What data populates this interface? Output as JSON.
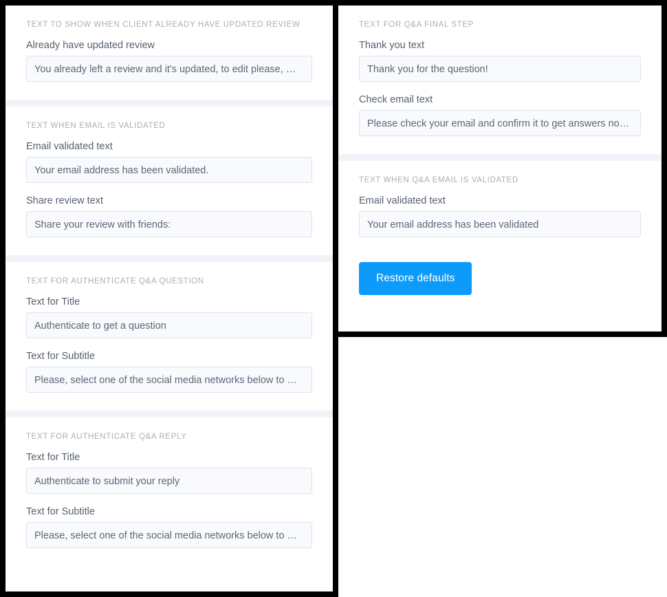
{
  "theme": {
    "accent": "#0d9bfb",
    "panel_border": "#000000",
    "divider": "#f1f3f8",
    "input_bg": "#f9fafd",
    "input_border": "#dfe3ee",
    "label_color": "#55606e",
    "section_head_color": "#a9aeb8"
  },
  "left_panel": {
    "sections": [
      {
        "heading": "TEXT TO SHOW WHEN CLIENT ALREADY HAVE UPDATED REVIEW",
        "fields": [
          {
            "label": "Already have updated review",
            "value": "You already left a review and it's updated, to edit please, …"
          }
        ]
      },
      {
        "heading": "TEXT WHEN EMAIL IS VALIDATED",
        "fields": [
          {
            "label": "Email validated text",
            "value": "Your email address has been validated."
          },
          {
            "label": "Share review text",
            "value": "Share your review with friends:"
          }
        ]
      },
      {
        "heading": "TEXT FOR AUTHENTICATE Q&A QUESTION",
        "fields": [
          {
            "label": "Text for Title",
            "value": "Authenticate to get a question"
          },
          {
            "label": "Text for Subtitle",
            "value": "Please, select one of the social media networks below to …"
          }
        ]
      },
      {
        "heading": "TEXT FOR AUTHENTICATE Q&A REPLY",
        "fields": [
          {
            "label": "Text for Title",
            "value": "Authenticate to submit your reply"
          },
          {
            "label": "Text for Subtitle",
            "value": "Please, select one of the social media networks below to …"
          }
        ]
      }
    ]
  },
  "right_panel": {
    "sections": [
      {
        "heading": "TEXT FOR Q&A FINAL STEP",
        "fields": [
          {
            "label": "Thank you text",
            "value": "Thank you for the question!"
          },
          {
            "label": "Check email text",
            "value": "Please check your email and confirm it to get answers no…"
          }
        ]
      },
      {
        "heading": "TEXT WHEN Q&A EMAIL IS VALIDATED",
        "fields": [
          {
            "label": "Email validated text",
            "value": "Your email address has been validated"
          }
        ]
      }
    ],
    "restore_button_label": "Restore defaults"
  }
}
